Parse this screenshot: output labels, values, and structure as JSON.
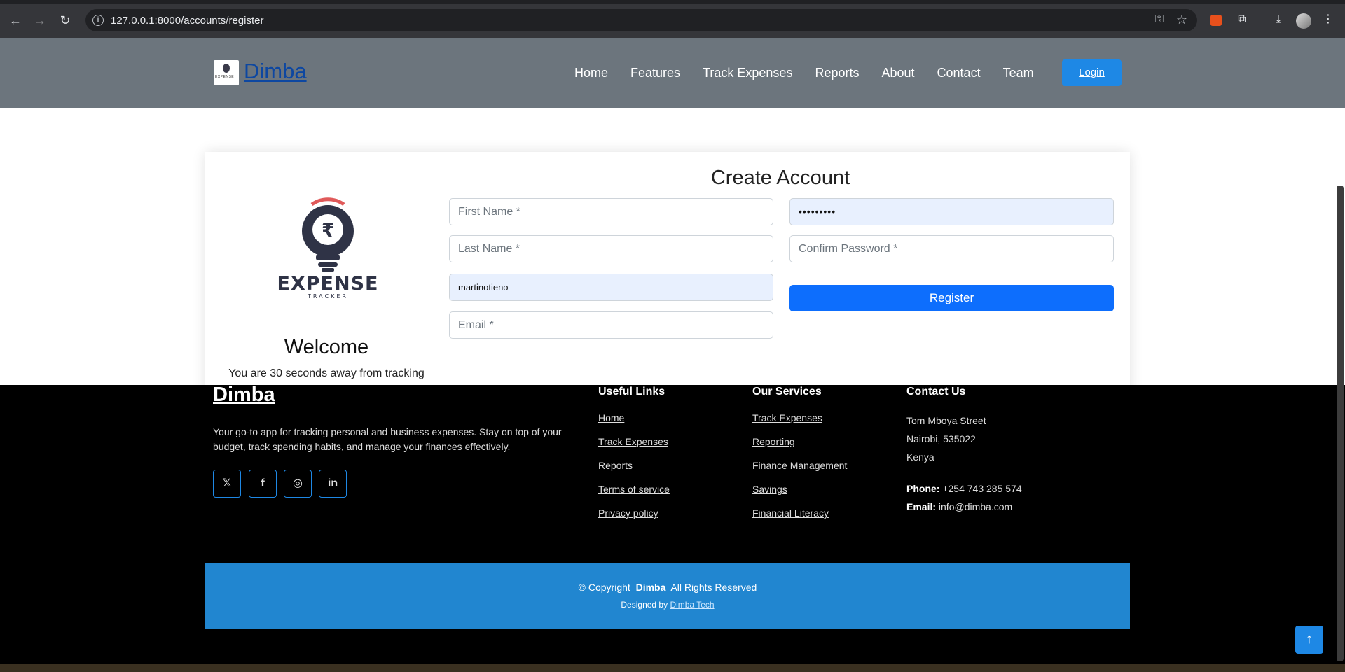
{
  "browser": {
    "url": "127.0.0.1:8000/accounts/register"
  },
  "header": {
    "brand": "Dimba",
    "logo_text": "EXPENSE",
    "nav": [
      "Home",
      "Features",
      "Track Expenses",
      "Reports",
      "About",
      "Contact",
      "Team"
    ],
    "login_label": "Login"
  },
  "welcome": {
    "title": "Welcome",
    "subtitle": "You are 30 seconds away from tracking"
  },
  "illustration": {
    "currency_symbol": "₹",
    "word": "EXPENSE",
    "tagline": "TRACKER"
  },
  "form": {
    "title": "Create Account",
    "first_name_placeholder": "First Name *",
    "last_name_placeholder": "Last Name *",
    "username_value": "martinotieno",
    "email_placeholder": "Email *",
    "password_value": "•••••••••",
    "confirm_password_placeholder": "Confirm Password *",
    "register_label": "Register"
  },
  "footer": {
    "brand": "Dimba",
    "about": "Your go-to app for tracking personal and business expenses. Stay on top of your budget, track spending habits, and manage your finances effectively.",
    "social": [
      "x-icon",
      "facebook-icon",
      "instagram-icon",
      "linkedin-icon"
    ],
    "useful_links_title": "Useful Links",
    "useful_links": [
      "Home",
      "Track Expenses",
      "Reports",
      "Terms of service",
      "Privacy policy"
    ],
    "services_title": "Our Services",
    "services": [
      "Track Expenses",
      "Reporting",
      "Finance Management",
      "Savings",
      "Financial Literacy"
    ],
    "contact_title": "Contact Us",
    "address": [
      "Tom Mboya Street",
      "Nairobi, 535022",
      "Kenya"
    ],
    "phone_label": "Phone:",
    "phone": "+254 743 285 574",
    "email_label": "Email:",
    "email": "info@dimba.com",
    "copyright_prefix": "© Copyright",
    "copyright_brand": "Dimba",
    "copyright_suffix": "All Rights Reserved",
    "designed_prefix": "Designed by",
    "designed_link": "Dimba Tech"
  },
  "colors": {
    "header_bg": "#6c757d",
    "accent": "#1e88e5",
    "register": "#0d6efd"
  }
}
